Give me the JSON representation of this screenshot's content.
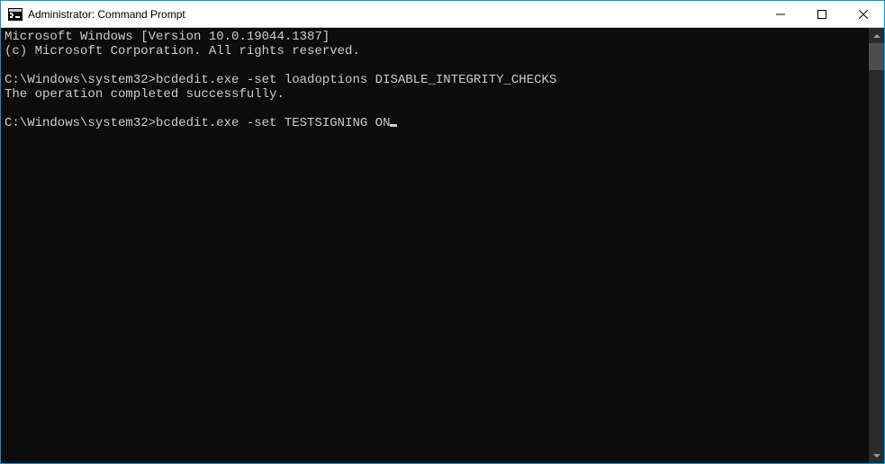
{
  "window": {
    "title": "Administrator: Command Prompt"
  },
  "terminal": {
    "lines": [
      "Microsoft Windows [Version 10.0.19044.1387]",
      "(c) Microsoft Corporation. All rights reserved.",
      "",
      "C:\\Windows\\system32>bcdedit.exe -set loadoptions DISABLE_INTEGRITY_CHECKS",
      "The operation completed successfully.",
      ""
    ],
    "current_prompt": "C:\\Windows\\system32>",
    "current_input": "bcdedit.exe -set TESTSIGNING ON"
  }
}
